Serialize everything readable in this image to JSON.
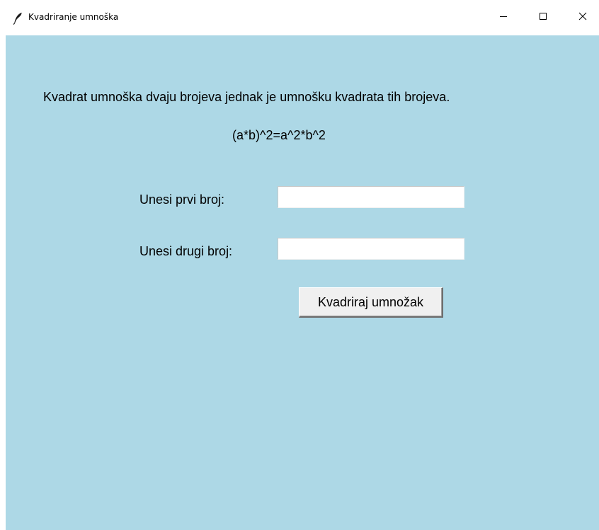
{
  "window": {
    "title": "Kvadriranje umnoška",
    "icon": "feather-icon",
    "controls": {
      "minimize_icon": "minimize-icon",
      "maximize_icon": "maximize-icon",
      "close_icon": "close-icon"
    }
  },
  "colors": {
    "background": "#add8e6",
    "titlebar": "#ffffff"
  },
  "content": {
    "headline": "Kvadrat umnoška dvaju brojeva jednak je umnošku kvadrata tih brojeva.",
    "formula": "(a*b)^2=a^2*b^2",
    "first_label": "Unesi prvi broj:",
    "first_value": "",
    "second_label": "Unesi drugi broj:",
    "second_value": "",
    "button_label": "Kvadriraj umnožak"
  }
}
